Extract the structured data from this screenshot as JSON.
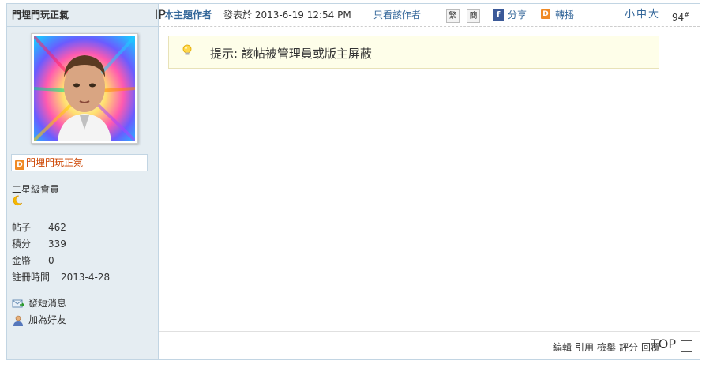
{
  "post": {
    "username": "門埋門玩正氣",
    "ip_tag": "IP",
    "profile": {
      "name_badge": "D",
      "name": "門埋門玩正氣",
      "rank": "二星級會員",
      "moon_icon": "crescent-moon-icon",
      "stats": [
        {
          "label": "帖子",
          "value": "462"
        },
        {
          "label": "積分",
          "value": "339"
        },
        {
          "label": "金幣",
          "value": "0"
        },
        {
          "label": "註冊時間",
          "value": "2013-4-28"
        }
      ],
      "actions": [
        {
          "label": "發短消息",
          "icon": "message-icon"
        },
        {
          "label": "加為好友",
          "icon": "add-friend-icon"
        }
      ]
    },
    "header": {
      "author_label": "本主題作者",
      "posted": "發表於 2013-6-19 12:54 PM",
      "only_author": "只看該作者",
      "trad": "繁",
      "simp": "簡",
      "fb_glyph": "f",
      "share": "分享",
      "d_glyph": "D",
      "repost": "轉播",
      "font_sizes": "小中大",
      "floor": "94",
      "floor_sup": "#"
    },
    "notice": {
      "text": "提示: 該帖被管理員或版主屏蔽"
    },
    "footer": {
      "links": [
        "編輯",
        "引用",
        "檢舉",
        "評分",
        "回覆"
      ],
      "top": "TOP"
    },
    "colors": {
      "link": "#336699",
      "side_bg": "#e5edf2",
      "notice_bg": "#fefee9"
    }
  }
}
